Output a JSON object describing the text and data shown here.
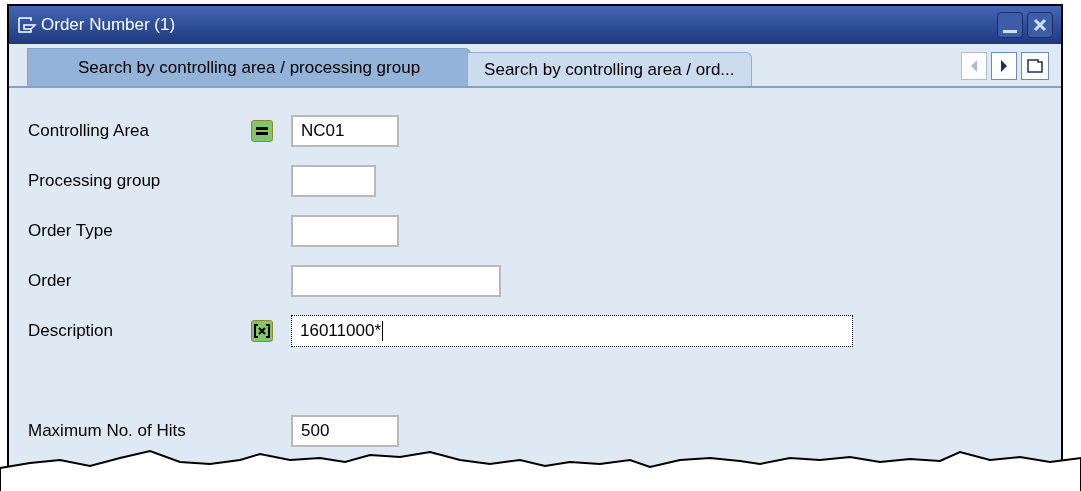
{
  "window": {
    "title": "Order Number (1)"
  },
  "tabs": [
    {
      "label": "Search by controlling area / processing group",
      "selected": true
    },
    {
      "label": "Search by controlling area / ord...",
      "selected": false
    }
  ],
  "fields": [
    {
      "label": "Controlling Area",
      "value": "NC01",
      "kind": "equal",
      "focused": false
    },
    {
      "label": "Processing group",
      "kind": "plain",
      "focused": false
    },
    {
      "label": "Order Type",
      "kind": "plain",
      "focused": false
    },
    {
      "label": "Order",
      "kind": "plain",
      "focused": false
    },
    {
      "label": "Description",
      "value": "16011000*",
      "kind": "pattern",
      "focused": true
    }
  ],
  "max_hits": {
    "label": "Maximum No. of Hits",
    "value": "500"
  }
}
